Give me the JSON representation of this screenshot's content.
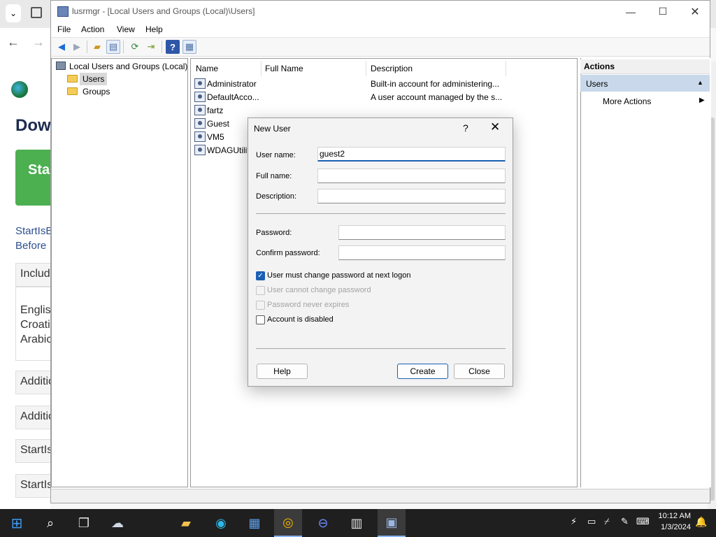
{
  "window": {
    "title": "lusrmgr - [Local Users and Groups (Local)\\Users]",
    "controls": {
      "minimize": "—",
      "maximize": "☐",
      "close": "✕"
    }
  },
  "menu": [
    "File",
    "Action",
    "View",
    "Help"
  ],
  "toolbar_icons": [
    "back-arrow-icon",
    "forward-arrow-icon",
    "up-folder-icon",
    "show-hide-tree-icon",
    "refresh-icon",
    "export-list-icon",
    "help-icon",
    "show-hide-action-pane-icon"
  ],
  "tree": {
    "root": "Local Users and Groups (Local)",
    "items": [
      "Users",
      "Groups"
    ],
    "selected": "Users"
  },
  "list": {
    "columns": [
      "Name",
      "Full Name",
      "Description"
    ],
    "rows": [
      {
        "name": "Administrator",
        "full_name": "",
        "description": "Built-in account for administering..."
      },
      {
        "name": "DefaultAcco...",
        "full_name": "",
        "description": "A user account managed by the s..."
      },
      {
        "name": "fartz",
        "full_name": "",
        "description": ""
      },
      {
        "name": "Guest",
        "full_name": "",
        "description": ""
      },
      {
        "name": "VM5",
        "full_name": "",
        "description": ""
      },
      {
        "name": "WDAGUtilit",
        "full_name": "",
        "description": ""
      }
    ]
  },
  "actions": {
    "header": "Actions",
    "section": "Users",
    "items": [
      "More Actions"
    ]
  },
  "dialog": {
    "title": "New User",
    "help_glyph": "?",
    "close_glyph": "✕",
    "labels": {
      "username": "User name:",
      "fullname": "Full name:",
      "description": "Description:",
      "password": "Password:",
      "confirm": "Confirm password:"
    },
    "values": {
      "username": "guest2",
      "fullname": "",
      "description": "",
      "password": "",
      "confirm": ""
    },
    "checkboxes": [
      {
        "label": "User must change password at next logon",
        "checked": true,
        "enabled": true
      },
      {
        "label": "User cannot change password",
        "checked": false,
        "enabled": false
      },
      {
        "label": "Password never expires",
        "checked": false,
        "enabled": false
      },
      {
        "label": "Account is disabled",
        "checked": false,
        "enabled": true
      }
    ],
    "buttons": {
      "help": "Help",
      "create": "Create",
      "close": "Close"
    }
  },
  "background": {
    "heading": "Dow",
    "start_button": "Sta",
    "text1": "StartIsB",
    "text2": "Before",
    "include": "Includ",
    "languages": [
      "English",
      "Croatia",
      "Arabic"
    ],
    "additional1": "Additio",
    "additional2": "Additio",
    "startis1": "StartIs",
    "startis2": "StartIs"
  },
  "taskbar": {
    "time": "10:12 AM",
    "date": "1/3/2024"
  }
}
